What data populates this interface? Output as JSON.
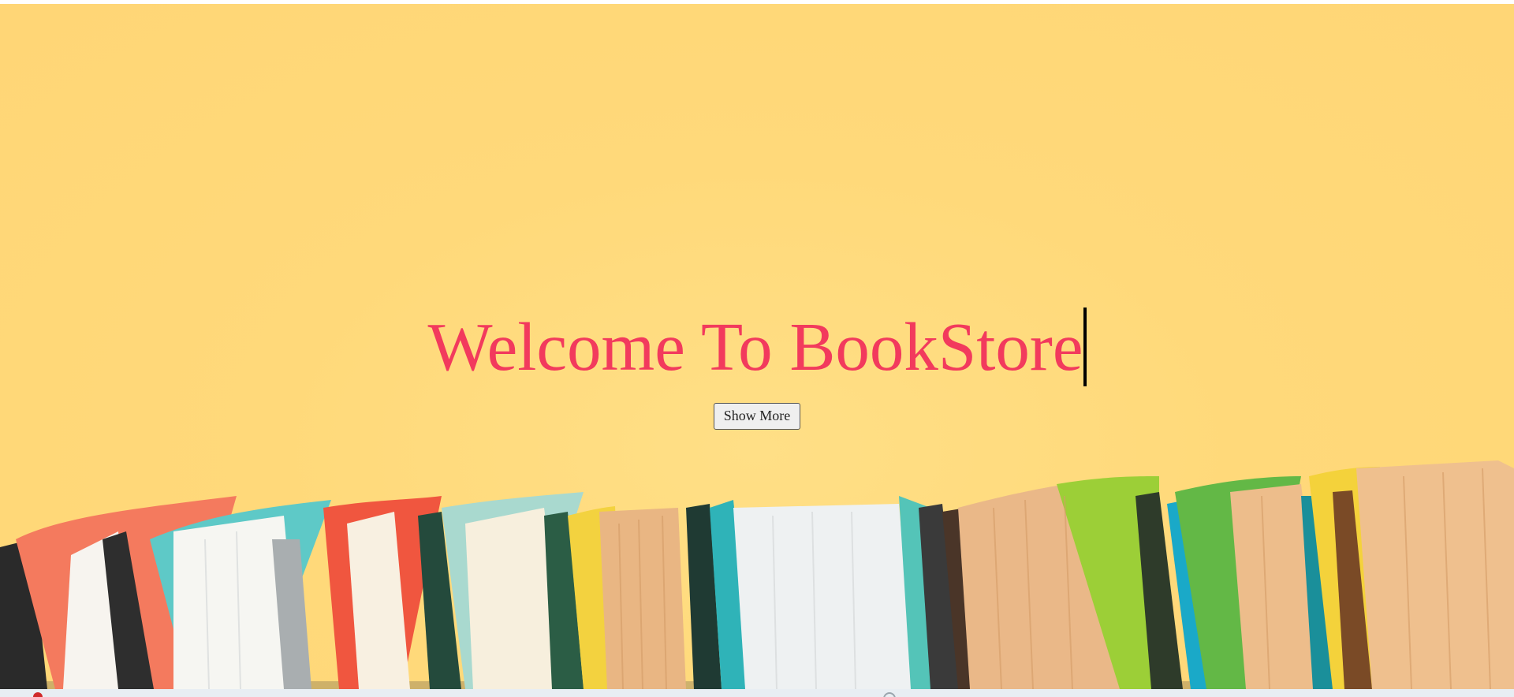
{
  "hero": {
    "headline": "Welcome To BookStore",
    "show_more_label": "Show More",
    "background_color": "#ffd97a",
    "headline_color": "#f23a5d",
    "image": "row-of-books-illustration"
  }
}
